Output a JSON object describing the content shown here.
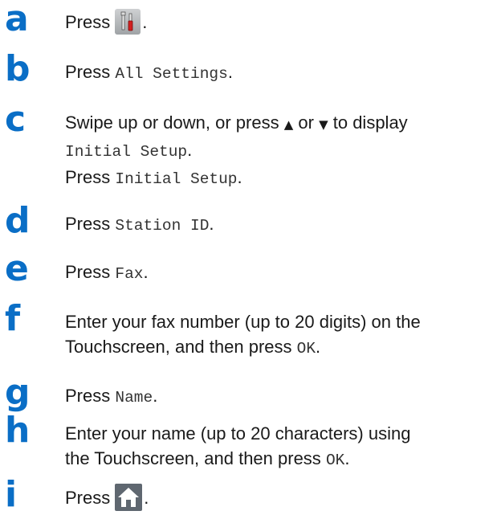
{
  "steps": [
    {
      "letter": "a",
      "press": "Press",
      "end": "."
    },
    {
      "letter": "b",
      "press": "Press",
      "mono": "All Settings",
      "end": "."
    },
    {
      "letter": "c",
      "line1_pre": "Swipe up or down, or press",
      "up_arrow": "▲",
      "or": "or",
      "down_arrow": "▼",
      "line1_post": "to display",
      "line2_mono": "Initial Setup",
      "line2_end": ".",
      "line3_pre": "Press",
      "line3_mono": "Initial Setup",
      "line3_end": "."
    },
    {
      "letter": "d",
      "press": "Press",
      "mono": "Station ID",
      "end": "."
    },
    {
      "letter": "e",
      "press": "Press",
      "mono": "Fax",
      "end": "."
    },
    {
      "letter": "f",
      "line1": "Enter your fax number (up to 20 digits) on the",
      "line2_pre": "Touchscreen, and then press",
      "line2_mono": "OK",
      "line2_end": "."
    },
    {
      "letter": "g",
      "press": "Press",
      "mono": "Name",
      "end": "."
    },
    {
      "letter": "h",
      "line1": "Enter your name (up to 20 characters) using",
      "line2_pre": "the Touchscreen, and then press",
      "line2_mono": "OK",
      "line2_end": "."
    },
    {
      "letter": "i",
      "press": "Press",
      "end": "."
    }
  ],
  "icons": {
    "settings_button": "settings-tools-icon",
    "home_button": "home-icon"
  },
  "colors": {
    "step_letter": "#0a6ec6",
    "text": "#1a1a1a"
  }
}
